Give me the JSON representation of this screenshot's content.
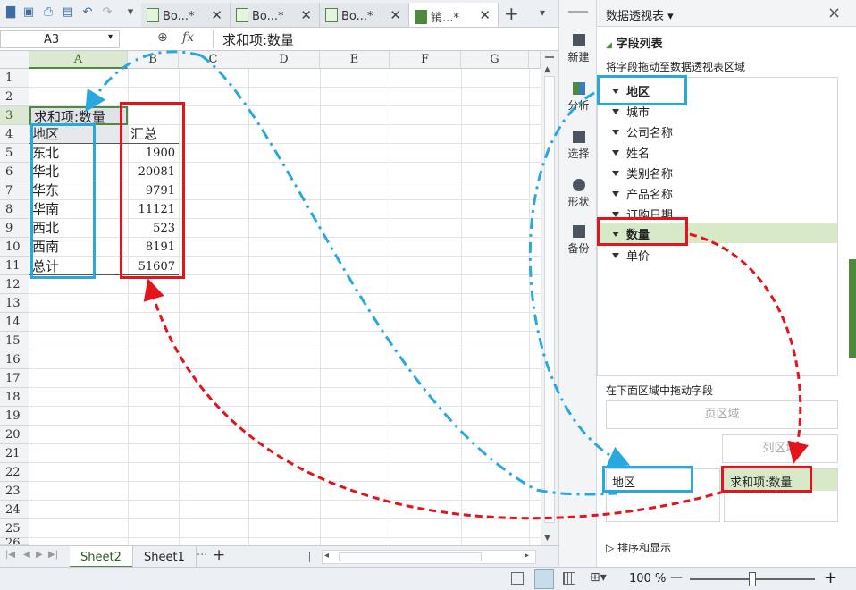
{
  "quick_access": {
    "icons": [
      "folder-icon",
      "save-icon",
      "print-icon",
      "preview-icon",
      "undo-icon",
      "redo-icon"
    ]
  },
  "tabs": [
    {
      "label": "Bo...",
      "modified": "*"
    },
    {
      "label": "Bo...",
      "modified": "*"
    },
    {
      "label": "Bo...",
      "modified": "*"
    },
    {
      "label": "销...",
      "modified": "*"
    }
  ],
  "formula_bar": {
    "cell_ref": "A3",
    "fx": "fx",
    "content": "求和项:数量"
  },
  "columns": [
    "A",
    "B",
    "C",
    "D",
    "E",
    "F",
    "G"
  ],
  "rows": [
    "1",
    "2",
    "3",
    "4",
    "5",
    "6",
    "7",
    "8",
    "9",
    "10",
    "11",
    "12",
    "13",
    "14",
    "15",
    "16",
    "17",
    "18",
    "19",
    "20",
    "21",
    "22",
    "23",
    "24",
    "25",
    "26"
  ],
  "pivot": {
    "title": "求和项:数量",
    "header_region": "地区",
    "header_total": "汇总",
    "rows": [
      {
        "region": "东北",
        "value": "1900"
      },
      {
        "region": "华北",
        "value": "20081"
      },
      {
        "region": "华东",
        "value": "9791"
      },
      {
        "region": "华南",
        "value": "11121"
      },
      {
        "region": "西北",
        "value": "523"
      },
      {
        "region": "西南",
        "value": "8191"
      },
      {
        "region": "总计",
        "value": "51607"
      }
    ]
  },
  "sheets": {
    "active": "Sheet2",
    "other": "Sheet1",
    "more": "···",
    "add": "+"
  },
  "side_toolbar": [
    {
      "label": "新建",
      "icon": "new-icon"
    },
    {
      "label": "分析",
      "icon": "analyze-icon"
    },
    {
      "label": "选择",
      "icon": "select-icon"
    },
    {
      "label": "形状",
      "icon": "shape-icon"
    },
    {
      "label": "备份",
      "icon": "backup-icon"
    }
  ],
  "panel": {
    "title": "数据透视表",
    "title_arrow": "▾",
    "close": "×",
    "field_list_header": "字段列表",
    "field_list_hint": "将字段拖动至数据透视表区域",
    "fields": [
      "地区",
      "城市",
      "公司名称",
      "姓名",
      "类别名称",
      "产品名称",
      "订购日期",
      "数量",
      "单价"
    ],
    "drag_hint": "在下面区域中拖动字段",
    "page_area": "页区域",
    "column_area": "列区域",
    "row_area_item": "地区",
    "value_area_item": "求和项:数量",
    "sort_display": "排序和显示"
  },
  "status": {
    "zoom": "100 %",
    "minus": "—",
    "plus": "+"
  },
  "colors": {
    "red": "#e3141b",
    "blue": "#29a8e0",
    "pivot_title_bg": "#dfe3e8",
    "selected_field_bg": "#d8e9c8"
  }
}
